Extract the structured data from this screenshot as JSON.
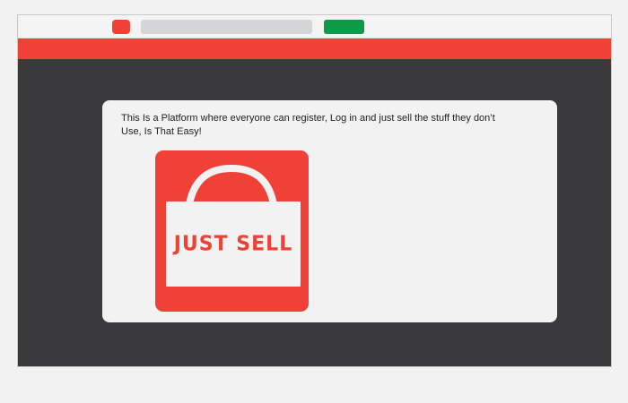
{
  "card": {
    "description": "This Is a Platform where everyone can register, Log in and just sell the stuff they don’t Use, Is That Easy!"
  },
  "logo": {
    "brand_text": "JUST SELL"
  },
  "colors": {
    "accent_red": "#ef4136",
    "go_green": "#0f9a47",
    "page_dark": "#3a3a3c",
    "url_bar_gray": "#d5d6d8"
  },
  "icons": {
    "logo_icon": "shopping-bag-icon"
  }
}
